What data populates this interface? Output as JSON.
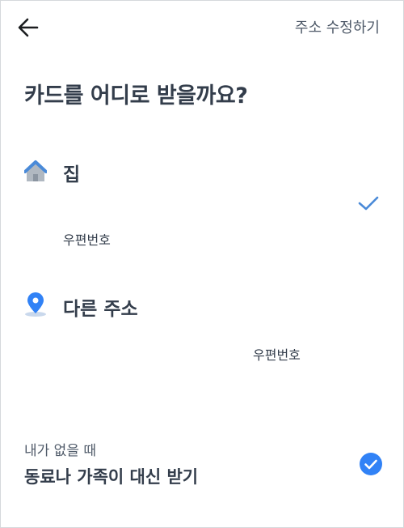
{
  "header": {
    "back_icon": "arrow-left-icon",
    "edit_label": "주소 수정하기"
  },
  "title": "카드를 어디로 받을까요?",
  "options": [
    {
      "icon": "home-icon",
      "label": "집",
      "postal": "우편번호",
      "selected": true
    },
    {
      "icon": "location-pin-icon",
      "label": "다른 주소",
      "postal": "우편번호",
      "selected": false
    }
  ],
  "proxy": {
    "subtitle": "내가 없을 때",
    "title": "동료나 가족이 대신 받기",
    "checked": true
  },
  "colors": {
    "accent": "#3182f6",
    "home_roof": "#4a8ad8",
    "home_body": "#b0b8c1",
    "text_primary": "#333d4b",
    "text_secondary": "#4e5968"
  }
}
